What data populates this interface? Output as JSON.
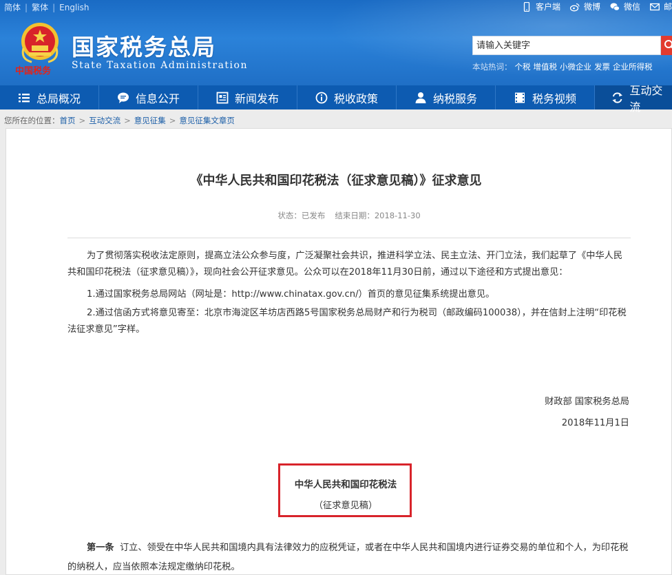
{
  "topbar": {
    "lang_simplified": "简体",
    "lang_traditional": "繁体",
    "lang_english": "English",
    "client": "客户端",
    "weibo": "微博",
    "wechat": "微信",
    "mail": "邮"
  },
  "header": {
    "emblem_caption": "中国税务",
    "title": "国家税务总局",
    "subtitle": "State Taxation Administration",
    "search_placeholder": "请输入关键字",
    "hot_label": "本站热词：",
    "hot_words": [
      "个税",
      "增值税",
      "小微企业",
      "发票",
      "企业所得税"
    ]
  },
  "nav": {
    "items": [
      {
        "label": "总局概况",
        "icon": "menu-icon"
      },
      {
        "label": "信息公开",
        "icon": "chat-bubble-icon"
      },
      {
        "label": "新闻发布",
        "icon": "news-icon"
      },
      {
        "label": "税收政策",
        "icon": "info-icon"
      },
      {
        "label": "纳税服务",
        "icon": "person-icon"
      },
      {
        "label": "税务视频",
        "icon": "film-icon"
      },
      {
        "label": "互动交流",
        "icon": "exchange-icon"
      }
    ]
  },
  "breadcrumb": {
    "prefix": "您所在的位置：",
    "items": [
      "首页",
      "互动交流",
      "意见征集",
      "意见征集文章页"
    ]
  },
  "article": {
    "title": "《中华人民共和国印花税法（征求意见稿）》征求意见",
    "status_label": "状态：",
    "status_value": "已发布",
    "end_label": "结束日期：",
    "end_value": "2018-11-30",
    "para1": "为了贯彻落实税收法定原则，提高立法公众参与度，广泛凝聚社会共识，推进科学立法、民主立法、开门立法，我们起草了《中华人民共和国印花税法（征求意见稿）》，现向社会公开征求意见。公众可以在2018年11月30日前，通过以下途径和方式提出意见：",
    "para2": "1.通过国家税务总局网站（网址是：http://www.chinatax.gov.cn/）首页的意见征集系统提出意见。",
    "para3": "2.通过信函方式将意见寄至：北京市海淀区羊坊店西路5号国家税务总局财产和行为税司（邮政编码100038），并在信封上注明“印花税法征求意见”字样。",
    "signer": "财政部 国家税务总局",
    "date": "2018年11月1日",
    "law_name": "中华人民共和国印花税法",
    "law_sub": "（征求意见稿）",
    "art1_label": "第一条",
    "art1_text": "订立、领受在中华人民共和国境内具有法律效力的应税凭证，或者在中华人民共和国境内进行证券交易的单位和个人，为印花税的纳税人，应当依照本法规定缴纳印花税。"
  }
}
